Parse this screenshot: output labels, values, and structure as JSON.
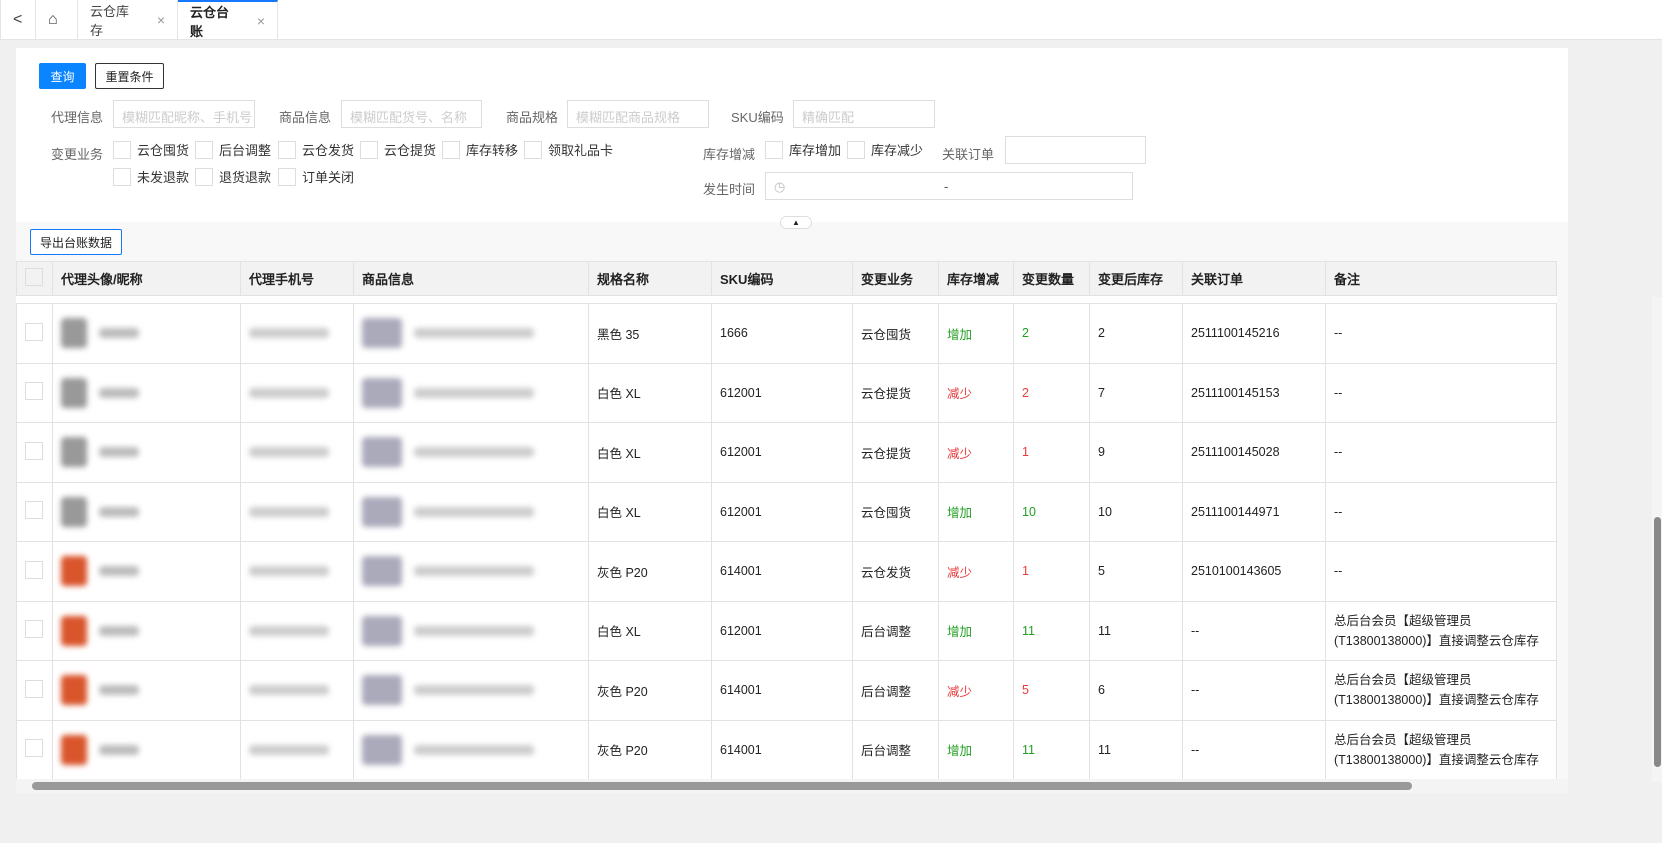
{
  "tabs": {
    "back": "<",
    "home_icon": "home-icon",
    "items": [
      {
        "label": "云仓库存",
        "close": "×"
      },
      {
        "label": "云仓台账",
        "close": "×",
        "active": true
      }
    ]
  },
  "toolbar": {
    "query": "查询",
    "reset": "重置条件",
    "export": "导出台账数据",
    "collapse": "▲"
  },
  "filters": {
    "agent": {
      "label": "代理信息",
      "placeholder": "模糊匹配昵称、手机号"
    },
    "product": {
      "label": "商品信息",
      "placeholder": "模糊匹配货号、名称"
    },
    "spec": {
      "label": "商品规格",
      "placeholder": "模糊匹配商品规格"
    },
    "sku": {
      "label": "SKU编码",
      "placeholder": "精确匹配"
    },
    "business": {
      "label": "变更业务",
      "options": [
        "云仓囤货",
        "后台调整",
        "云仓发货",
        "云仓提货",
        "库存转移",
        "领取礼品卡",
        "未发退款",
        "退货退款",
        "订单关闭"
      ]
    },
    "change": {
      "label": "库存增减",
      "options": [
        "库存增加",
        "库存减少"
      ]
    },
    "order": {
      "label": "关联订单",
      "value": ""
    },
    "time": {
      "label": "发生时间",
      "separator": "-"
    }
  },
  "colors": {
    "primary": "#0a84ff",
    "increase": "#22a022",
    "decrease": "#e83a3a"
  },
  "table": {
    "headers": [
      "代理头像/昵称",
      "代理手机号",
      "商品信息",
      "规格名称",
      "SKU编码",
      "变更业务",
      "库存增减",
      "变更数量",
      "变更后库存",
      "关联订单",
      "备注"
    ],
    "rows": [
      {
        "spec": "黑色 35",
        "sku": "1666",
        "biz": "云仓囤货",
        "dir": "增加",
        "type": "inc",
        "qty": "2",
        "after": "2",
        "order": "2511100145216",
        "remark": "--"
      },
      {
        "spec": "白色 XL",
        "sku": "612001",
        "biz": "云仓提货",
        "dir": "减少",
        "type": "dec",
        "qty": "2",
        "after": "7",
        "order": "2511100145153",
        "remark": "--"
      },
      {
        "spec": "白色 XL",
        "sku": "612001",
        "biz": "云仓提货",
        "dir": "减少",
        "type": "dec",
        "qty": "1",
        "after": "9",
        "order": "2511100145028",
        "remark": "--"
      },
      {
        "spec": "白色 XL",
        "sku": "612001",
        "biz": "云仓囤货",
        "dir": "增加",
        "type": "inc",
        "qty": "10",
        "after": "10",
        "order": "2511100144971",
        "remark": "--"
      },
      {
        "spec": "灰色 P20",
        "sku": "614001",
        "biz": "云仓发货",
        "dir": "减少",
        "type": "dec",
        "qty": "1",
        "after": "5",
        "order": "2510100143605",
        "remark": "--"
      },
      {
        "spec": "白色 XL",
        "sku": "612001",
        "biz": "后台调整",
        "dir": "增加",
        "type": "inc",
        "qty": "11",
        "after": "11",
        "order": "--",
        "remark": "总后台会员【超级管理员(T13800138000)】直接调整云仓库存"
      },
      {
        "spec": "灰色 P20",
        "sku": "614001",
        "biz": "后台调整",
        "dir": "减少",
        "type": "dec",
        "qty": "5",
        "after": "6",
        "order": "--",
        "remark": "总后台会员【超级管理员(T13800138000)】直接调整云仓库存"
      },
      {
        "spec": "灰色 P20",
        "sku": "614001",
        "biz": "后台调整",
        "dir": "增加",
        "type": "inc",
        "qty": "11",
        "after": "11",
        "order": "--",
        "remark": "总后台会员【超级管理员(T13800138000)】直接调整云仓库存"
      }
    ]
  }
}
